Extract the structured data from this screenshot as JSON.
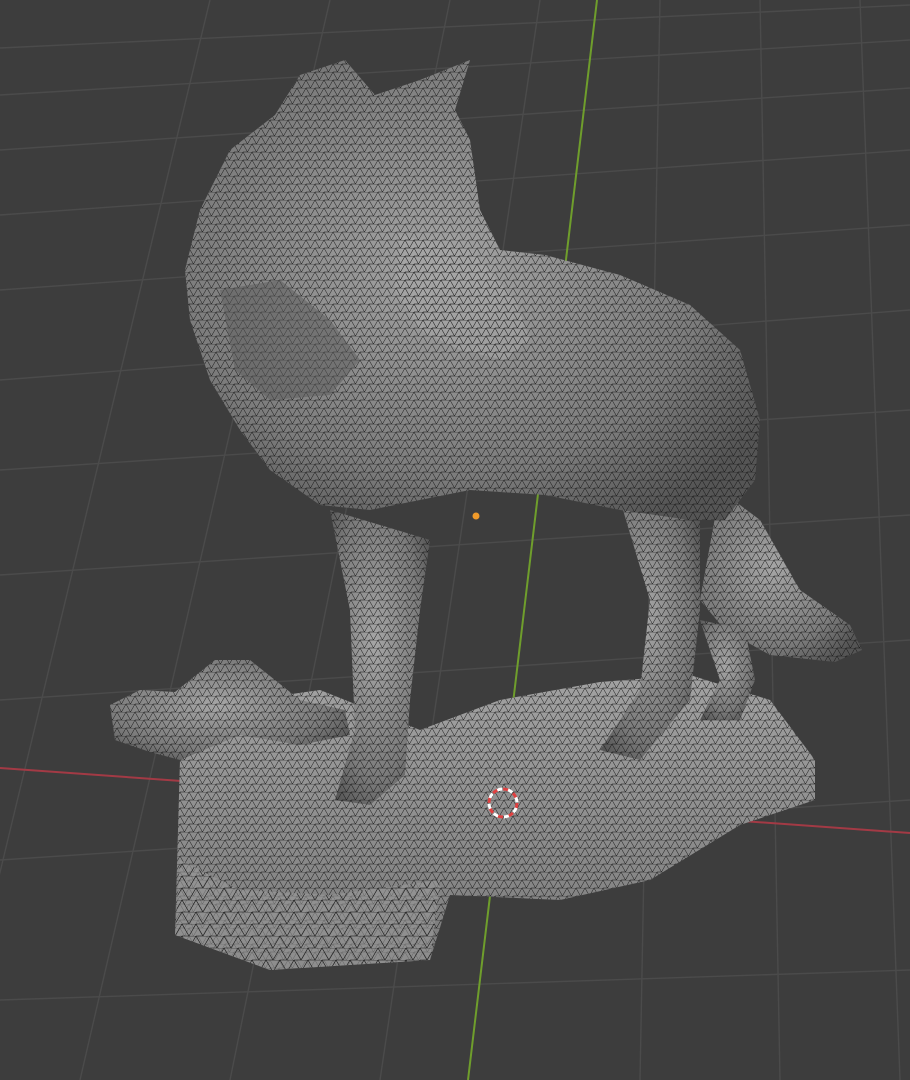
{
  "viewport": {
    "background": "#3d3d3d",
    "grid_color": "#4a4a4a",
    "axis_x_color": "#a33a45",
    "axis_y_color": "#6f9e2c"
  },
  "model": {
    "fill_color": "#8a8a8a",
    "wire_color": "#111111"
  },
  "origin_marker": {
    "color": "#f09a2a"
  },
  "cursor_3d": {
    "ring_color": "#e04040"
  }
}
